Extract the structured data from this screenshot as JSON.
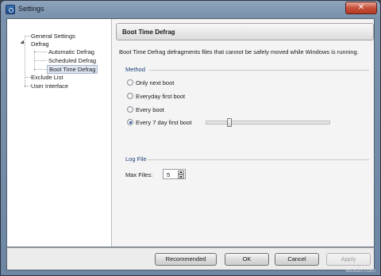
{
  "window": {
    "title": "Settings",
    "close_glyph": "✕"
  },
  "tree": {
    "items": [
      {
        "label": "General Settings"
      },
      {
        "label": "Defrag"
      },
      {
        "label": "Automatic Defrag"
      },
      {
        "label": "Scheduled Defrag"
      },
      {
        "label": "Boot Time Defrag",
        "selected": true
      },
      {
        "label": "Exclude List"
      },
      {
        "label": "User Interface"
      }
    ]
  },
  "panel": {
    "header": "Boot Time Defrag",
    "description": "Boot Time Defrag defragments files that cannot be safely moved while Windows is running.",
    "method": {
      "label": "Method",
      "options": [
        {
          "label": "Only next boot",
          "checked": false
        },
        {
          "label": "Everyday first boot",
          "checked": false
        },
        {
          "label": "Every boot",
          "checked": false
        },
        {
          "label": "Every 7 day first boot",
          "checked": true
        }
      ],
      "slider_level_fraction": 0.18
    },
    "log_file": {
      "label": "Log File",
      "max_files_label": "Max Files:",
      "max_files_value": "5"
    }
  },
  "buttons": {
    "recommended": "Recommended",
    "ok": "OK",
    "cancel": "Cancel",
    "apply": "Apply"
  },
  "watermark": "wsxdn.com"
}
